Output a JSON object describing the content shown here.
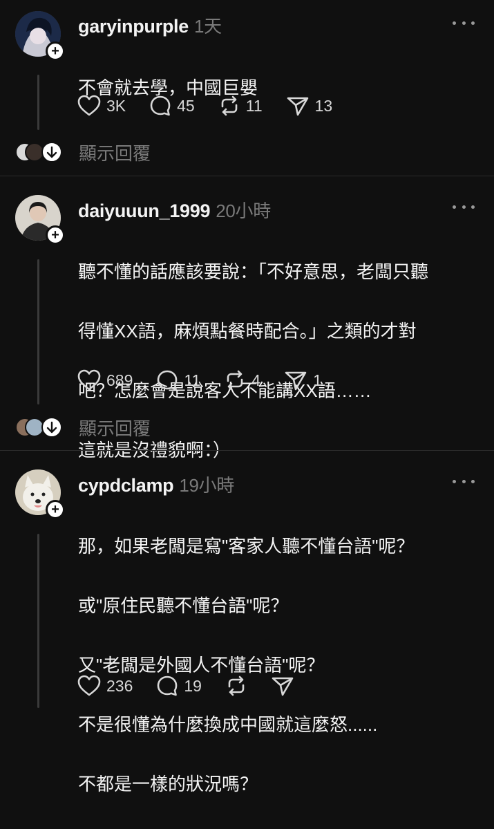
{
  "posts": [
    {
      "username": "garyinpurple",
      "time": "1天",
      "lines": [
        "不會就去學，中國巨嬰"
      ],
      "likes": "3K",
      "comments": "45",
      "reposts": "11",
      "shares": "13",
      "show_replies": "顯示回覆",
      "avatar_colors": [
        "#1c2a48",
        "#c9c9d4"
      ]
    },
    {
      "username": "daiyuuun_1999",
      "time": "20小時",
      "lines": [
        "聽不懂的話應該要說：「不好意思，老闆只聽",
        "得懂XX語，麻煩點餐時配合。」之類的才對",
        "吧？怎麼會是說客人不能講XX語……",
        "這就是沒禮貌啊：）"
      ],
      "likes": "689",
      "comments": "11",
      "reposts": "4",
      "shares": "1",
      "show_replies": "顯示回覆",
      "avatar_colors": [
        "#d8d4cc",
        "#2a2a2a"
      ]
    },
    {
      "username": "cypdclamp",
      "time": "19小時",
      "lines": [
        "那，如果老闆是寫\"客家人聽不懂台語\"呢？",
        "或\"原住民聽不懂台語\"呢？",
        "又\"老闆是外國人不懂台語\"呢？",
        "不是很懂為什麼換成中國就這麼怒......",
        "不都是一樣的狀況嗎？"
      ],
      "likes": "236",
      "comments": "19",
      "reposts": "",
      "shares": "",
      "avatar_colors": [
        "#d6cfbf",
        "#f2f0ea"
      ]
    }
  ],
  "icons": {
    "like": "heart-icon",
    "comment": "comment-icon",
    "repost": "repost-icon",
    "share": "send-icon",
    "more": "more-dots-icon",
    "follow": "plus-icon",
    "expand": "arrow-down-icon"
  },
  "colors": {
    "background": "#101010",
    "text": "#f3f3f3",
    "muted": "#7a7a7a",
    "divider": "#2c2c2c"
  }
}
